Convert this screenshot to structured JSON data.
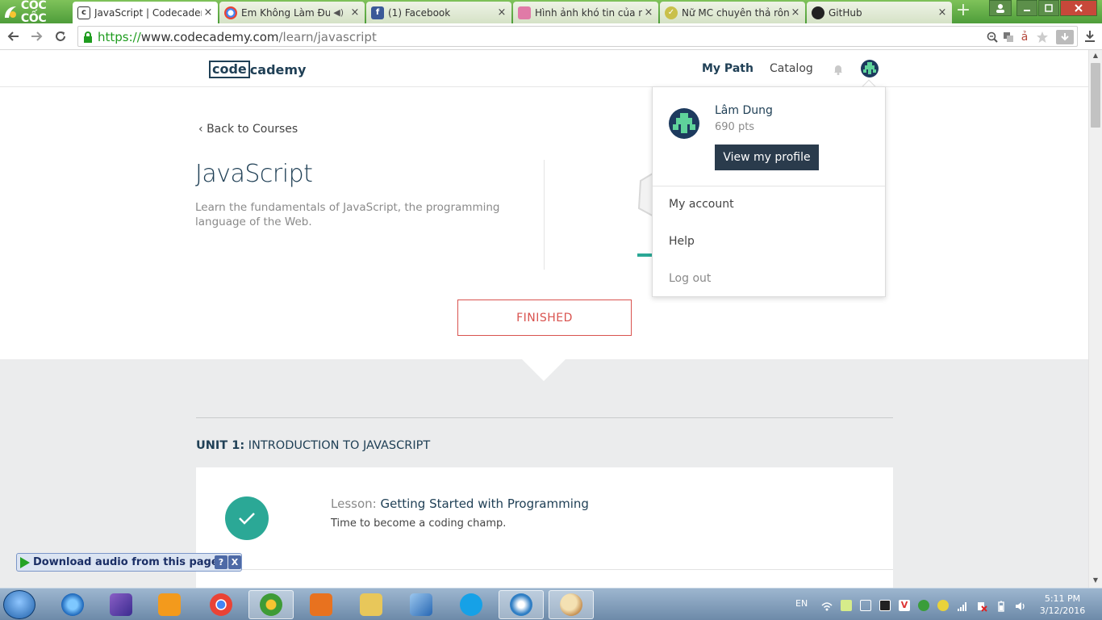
{
  "browser": {
    "brand": "CỐC CỐC",
    "tabs": [
      {
        "title": "JavaScript | Codecademy",
        "active": true,
        "favicon": "codecademy-icon"
      },
      {
        "title": "Em Không Làm Được",
        "active": false,
        "favicon": "chrome-icon",
        "audio": true
      },
      {
        "title": "(1) Facebook",
        "active": false,
        "favicon": "facebook-icon"
      },
      {
        "title": "Hình ảnh khó tin của nữ",
        "active": false,
        "favicon": "image-icon"
      },
      {
        "title": "Nữ MC chuyên thả rông",
        "active": false,
        "favicon": "news-icon"
      },
      {
        "title": "GitHub",
        "active": false,
        "favicon": "github-icon"
      }
    ],
    "tab_close": "×",
    "new_tab": "+",
    "url_scheme": "https://",
    "url_host": "www.codecademy.com",
    "url_path": "/learn/javascript"
  },
  "site": {
    "logo_code": "code",
    "logo_rest": "cademy",
    "nav": {
      "my_path": "My Path",
      "catalog": "Catalog"
    }
  },
  "course": {
    "back": "Back to Courses",
    "title": "JavaScript",
    "description": "Learn the fundamentals of JavaScript, the programming language of the Web.",
    "status": "FINISHED"
  },
  "unit": {
    "number_label": "UNIT 1:",
    "title": "INTRODUCTION TO JAVASCRIPT",
    "lesson": {
      "label": "Lesson:",
      "name": "Getting Started with Programming",
      "subtitle": "Time to become a coding champ."
    }
  },
  "dropdown": {
    "user_name": "Lâm Dung",
    "points": "690 pts",
    "profile_button": "View my profile",
    "items": [
      "My account",
      "Help",
      "Log out"
    ]
  },
  "extension_bar": {
    "label": "Download audio from this page",
    "help": "?",
    "close": "X"
  },
  "taskbar": {
    "language": "EN",
    "time": "5:11 PM",
    "date": "3/12/2016"
  },
  "colors": {
    "brand_navy": "#204056",
    "teal": "#2ba896",
    "finished_red": "#d9534f",
    "browser_green": "#4e9d3a"
  }
}
